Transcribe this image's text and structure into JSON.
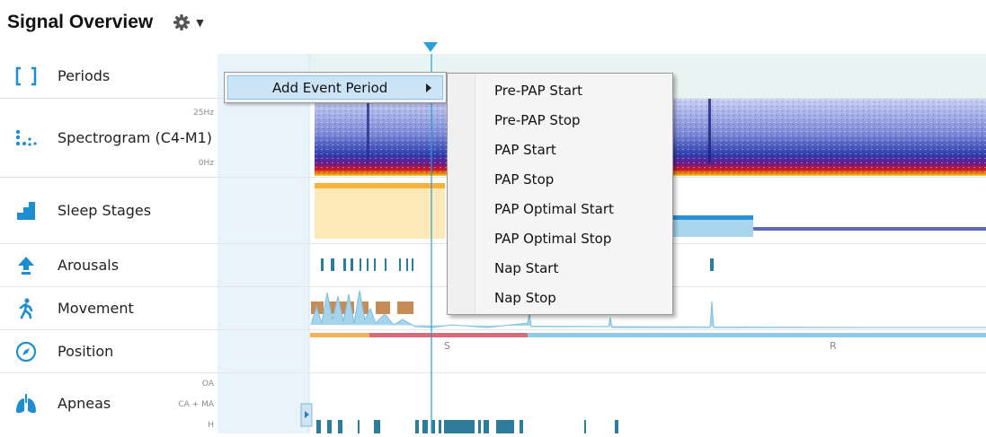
{
  "header": {
    "title": "Signal Overview",
    "settings_icon": "gear-icon",
    "dropdown_icon": "caret-down-icon"
  },
  "rows": [
    {
      "label": "Periods",
      "icon": "brackets-icon"
    },
    {
      "label": "Spectrogram (C4-M1)",
      "icon": "dots-icon",
      "scale_top": "25Hz",
      "scale_bottom": "0Hz"
    },
    {
      "label": "Sleep Stages",
      "icon": "stairs-icon"
    },
    {
      "label": "Arousals",
      "icon": "arrow-up-icon"
    },
    {
      "label": "Movement",
      "icon": "walking-person-icon"
    },
    {
      "label": "Position",
      "icon": "compass-icon",
      "markers": [
        "S",
        "R"
      ]
    },
    {
      "label": "Apneas",
      "icon": "lungs-icon",
      "scale_top": "OA",
      "scale_mid": "CA + MA",
      "scale_bottom": "H"
    }
  ],
  "context_menu": {
    "item": "Add Event Period",
    "submenu": [
      "Pre-PAP Start",
      "Pre-PAP Stop",
      "PAP Start",
      "PAP Stop",
      "PAP Optimal Start",
      "PAP Optimal Stop",
      "Nap Start",
      "Nap Stop"
    ]
  },
  "colors": {
    "accent": "#2aa1d6",
    "spectrogram_low": "#b7c0f0",
    "spectrogram_high": "#c00000",
    "stage_awake": "#fde8b8",
    "stage_bar": "#f5b23c",
    "stage_rem": "#2b8fd6",
    "stage_deep": "#5d6bbd",
    "event": "#2d7c9a",
    "movement": "#c78b57",
    "position_supine": "#d66c79",
    "position_right": "#8fcbe8"
  }
}
